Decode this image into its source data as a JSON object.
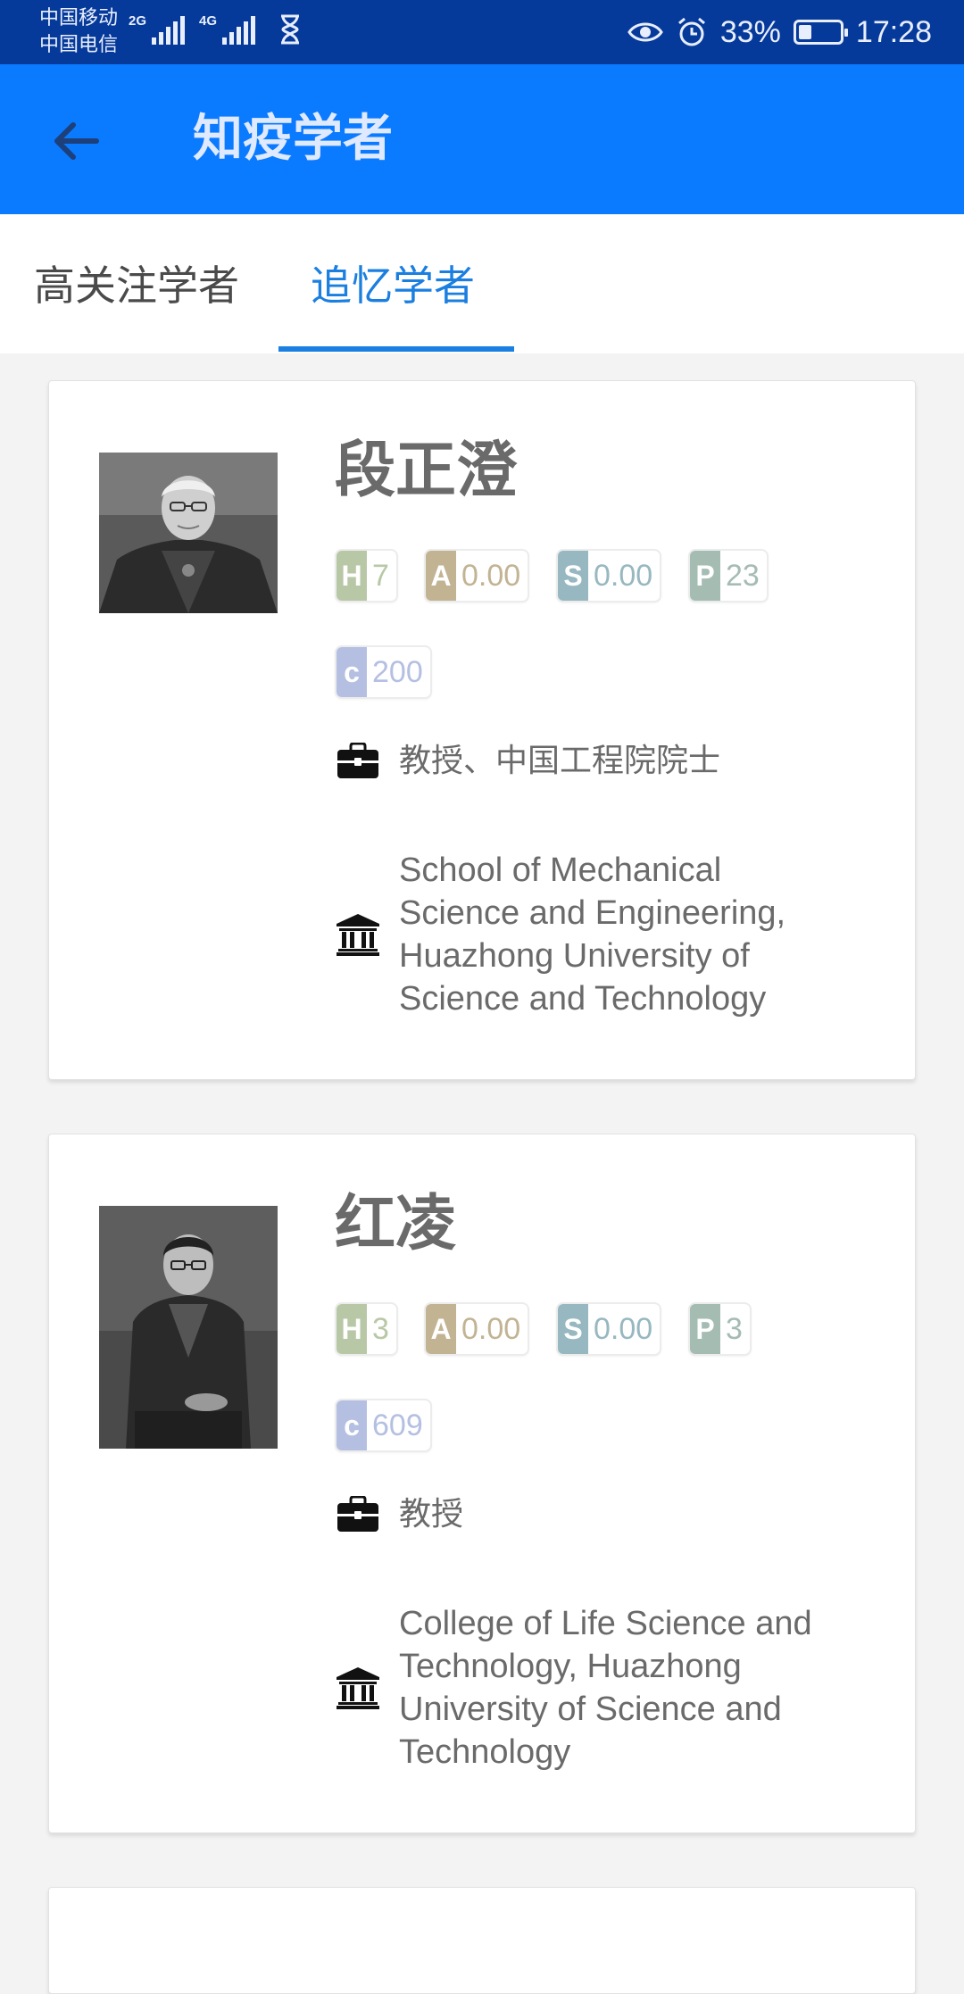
{
  "status_bar": {
    "carrier_1": "中国移动",
    "carrier_2": "中国电信",
    "signal_1_tag": "2G",
    "signal_2_tag": "4G",
    "battery": "33%",
    "time": "17:28",
    "icons": [
      "signal-icon",
      "hourglass-icon",
      "eye-icon",
      "alarm-icon",
      "battery-icon"
    ]
  },
  "app_bar": {
    "title": "知疫学者",
    "back_icon": "arrow-left-icon"
  },
  "tabs": [
    {
      "label": "高关注学者",
      "active": false
    },
    {
      "label": "追忆学者",
      "active": true
    }
  ],
  "colors": {
    "status_bar": "#063a9a",
    "app_bar": "#0a7bff",
    "active_tab": "#1a7fe0",
    "h_badge": "#b8c8a6",
    "a_badge": "#c2b393",
    "s_badge": "#97b8c0",
    "p_badge": "#a5bcb3",
    "c_badge": "#b4bfe2"
  },
  "scholars": [
    {
      "name": "段正澄",
      "metrics": {
        "h": "7",
        "a": "0.00",
        "s": "0.00",
        "p": "23",
        "c": "200"
      },
      "metric_keys": {
        "h": "H",
        "a": "A",
        "s": "S",
        "p": "P",
        "c": "c"
      },
      "position": "教授、中国工程院院士",
      "organization": "School of Mechanical Science and Engineering, Huazhong University of Science and Technology"
    },
    {
      "name": "红凌",
      "metrics": {
        "h": "3",
        "a": "0.00",
        "s": "0.00",
        "p": "3",
        "c": "609"
      },
      "metric_keys": {
        "h": "H",
        "a": "A",
        "s": "S",
        "p": "P",
        "c": "c"
      },
      "position": "教授",
      "organization": "College of Life Science and Technology, Huazhong University of Science and Technology"
    }
  ]
}
